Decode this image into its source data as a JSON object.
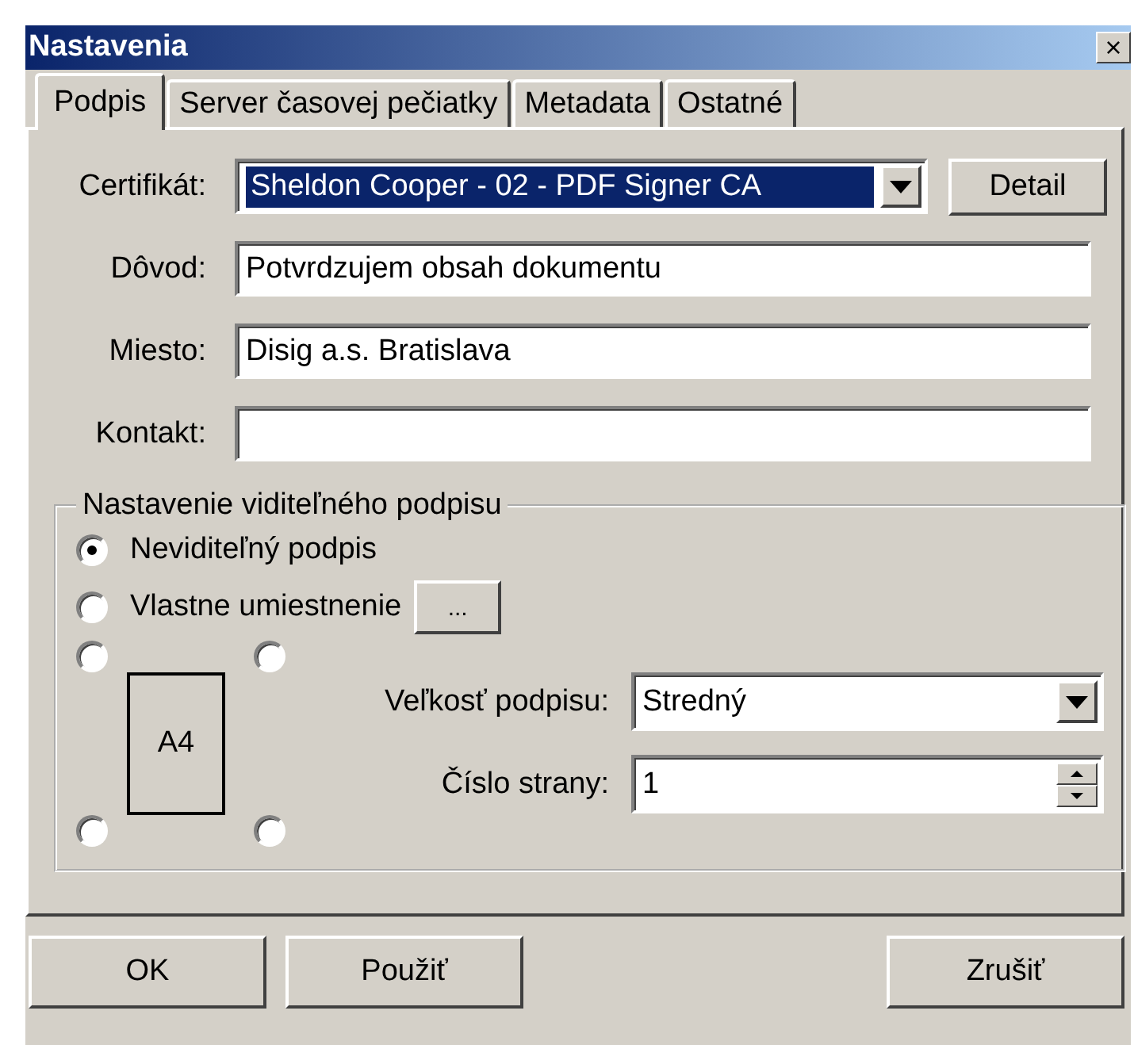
{
  "window": {
    "title": "Nastavenia",
    "close": "×"
  },
  "tabs": [
    {
      "label": "Podpis",
      "selected": true
    },
    {
      "label": "Server časovej pečiatky",
      "selected": false
    },
    {
      "label": "Metadata",
      "selected": false
    },
    {
      "label": "Ostatné",
      "selected": false
    }
  ],
  "fields": [
    {
      "kind": "select",
      "label": "Certifikát:",
      "value": "Sheldon Cooper - 02 - PDF Signer CA",
      "button": "Detail"
    },
    {
      "kind": "text",
      "label": "Dôvod:",
      "value": "Potvrdzujem obsah dokumentu"
    },
    {
      "kind": "text",
      "label": "Miesto:",
      "value": "Disig a.s. Bratislava"
    },
    {
      "kind": "text",
      "label": "Kontakt:"
    }
  ],
  "group": {
    "title": "Nastavenie viditeľného podpisu",
    "options": [
      {
        "label": "Neviditeľný podpis",
        "selected": true
      },
      {
        "label": "Vlastne umiestnenie",
        "selected": false,
        "button": "..."
      }
    ],
    "corners": [
      {
        "selected": false
      },
      {
        "selected": false
      },
      {
        "selected": false
      },
      {
        "selected": false
      }
    ],
    "page_label": "A4",
    "size_label": "Veľkosť podpisu:",
    "size_value": "Stredný",
    "page_number_label": "Číslo strany:",
    "page_number_value": "1"
  },
  "buttons": [
    {
      "label": "OK"
    },
    {
      "label": "Použiť"
    },
    {
      "label": "Zrušiť"
    }
  ]
}
